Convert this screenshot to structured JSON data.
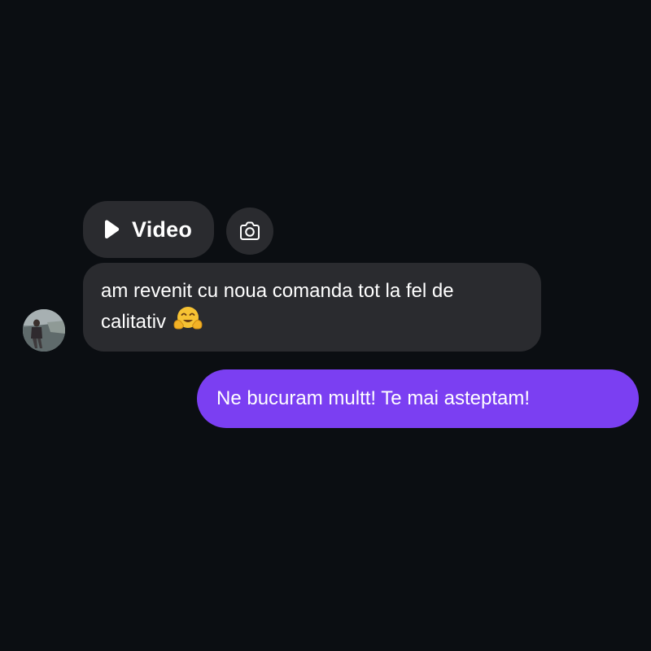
{
  "colors": {
    "background": "#0b0e12",
    "incoming_bubble": "#2a2b2f",
    "outgoing_bubble": "#7b3ff2",
    "text": "#ffffff"
  },
  "attachment": {
    "video_label": "Video",
    "video_icon": "play-icon",
    "camera_icon": "camera-icon"
  },
  "incoming_message": {
    "text": "am revenit cu noua comanda tot la fel de calitativ",
    "emoji": "🤗",
    "emoji_icon": "hugging-face-emoji"
  },
  "outgoing_message": {
    "text": "Ne bucuram multt! Te mai asteptam!"
  }
}
